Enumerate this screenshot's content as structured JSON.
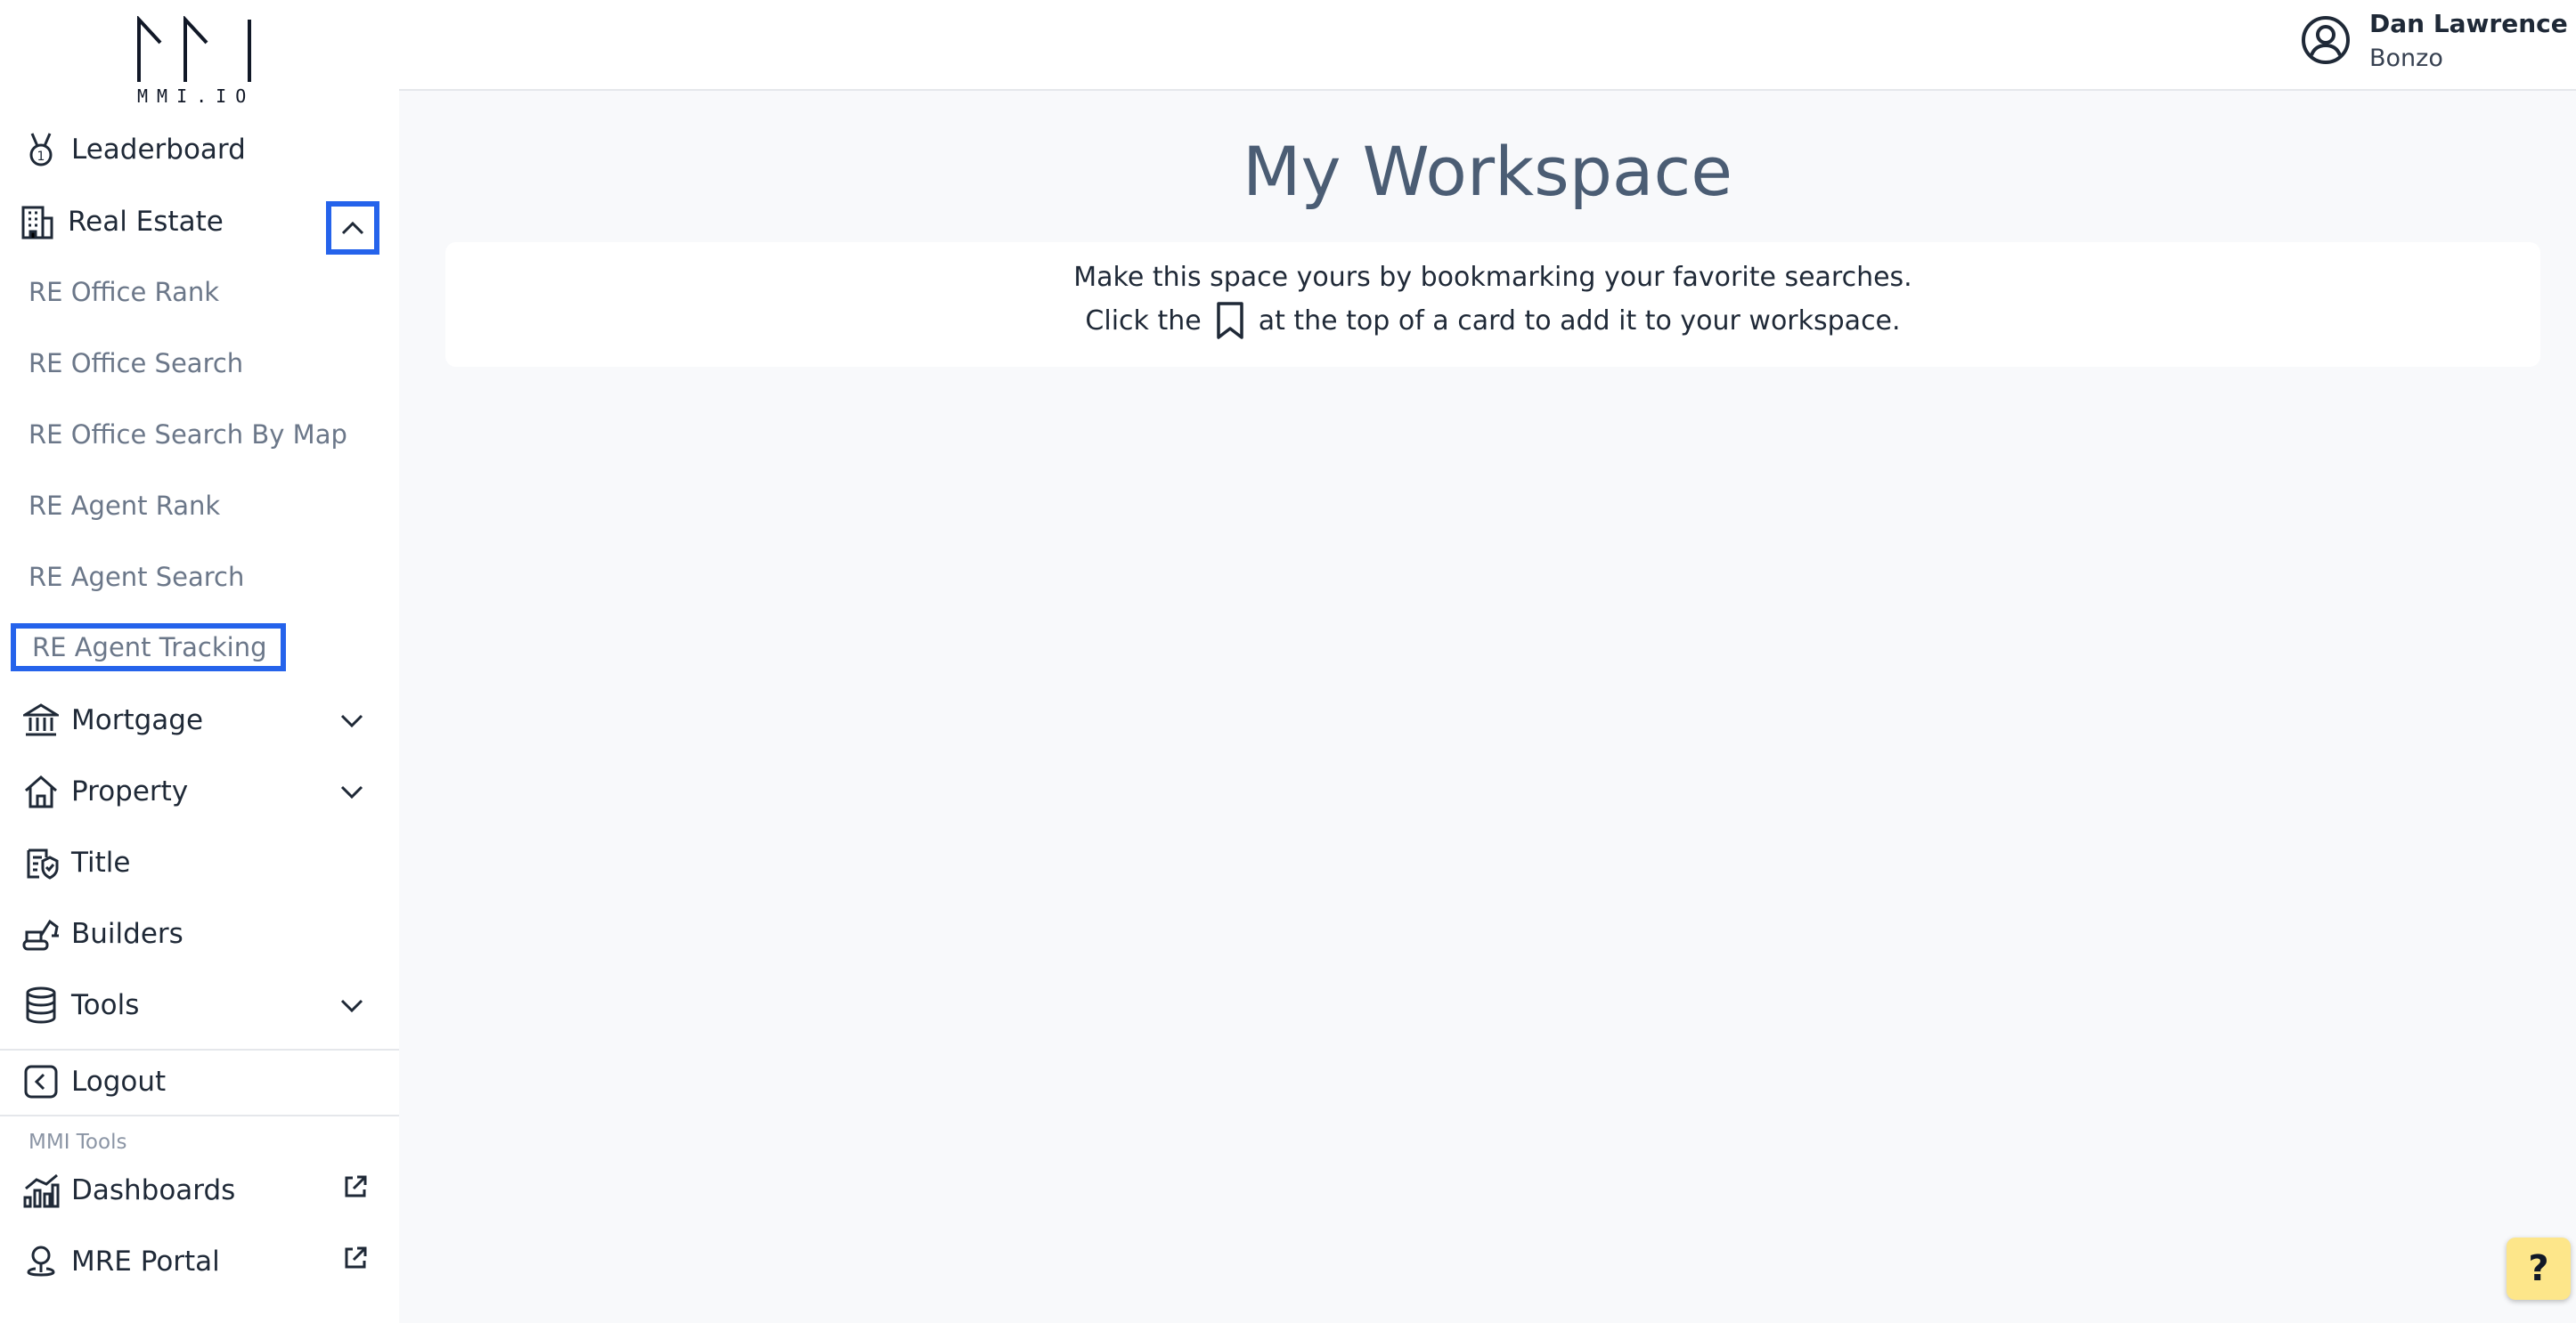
{
  "brand": {
    "logo_text": "MMI.IO"
  },
  "sidebar": {
    "leaderboard": {
      "label": "Leaderboard",
      "icon": "medal-icon"
    },
    "real_estate": {
      "label": "Real Estate",
      "icon": "building-icon",
      "expanded": true,
      "sub_items": [
        {
          "label": "RE Office Rank"
        },
        {
          "label": "RE Office Search"
        },
        {
          "label": "RE Office Search By Map"
        },
        {
          "label": "RE Agent Rank"
        },
        {
          "label": "RE Agent Search"
        },
        {
          "label": "RE Agent Tracking"
        }
      ]
    },
    "mortgage": {
      "label": "Mortgage",
      "icon": "bank-icon"
    },
    "property": {
      "label": "Property",
      "icon": "house-icon"
    },
    "title": {
      "label": "Title",
      "icon": "certificate-icon"
    },
    "builders": {
      "label": "Builders",
      "icon": "excavator-icon"
    },
    "tools": {
      "label": "Tools",
      "icon": "database-icon"
    },
    "logout": {
      "label": "Logout",
      "icon": "chevron-left-square-icon"
    },
    "section_label": "MMI Tools",
    "external": [
      {
        "label": "Dashboards",
        "icon": "chart-icon"
      },
      {
        "label": "MRE Portal",
        "icon": "map-pin-icon"
      }
    ]
  },
  "header": {
    "user_name": "Dan Lawrence",
    "user_org": "Bonzo"
  },
  "main": {
    "title": "My Workspace",
    "card_line1": "Make this space yours by bookmarking your favorite searches.",
    "card_line2_before": "Click the",
    "card_line2_after": "at the top of a card to add it to your workspace."
  },
  "help": {
    "label": "?"
  },
  "colors": {
    "accent": "#2563eb",
    "title": "#4b5d74",
    "sub_item": "#6b7789",
    "help_bg": "#fde68a",
    "background": "#f8f9fb"
  }
}
